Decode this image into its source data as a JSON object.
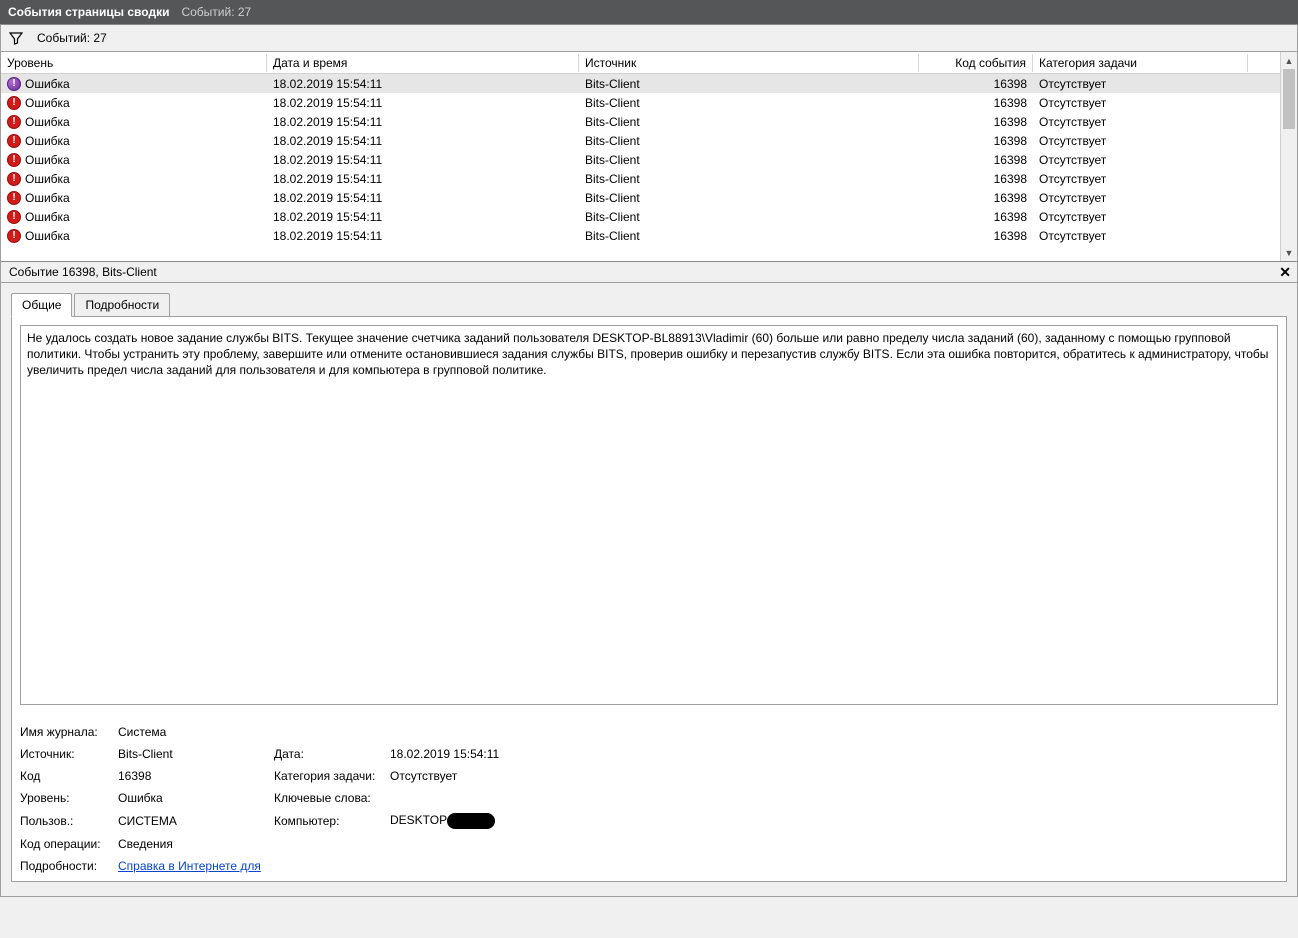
{
  "titlebar": {
    "title": "События страницы сводки",
    "subtitle": "Событий: 27"
  },
  "filterbar": {
    "count_label": "Событий: 27"
  },
  "columns": {
    "level": "Уровень",
    "date": "Дата и время",
    "source": "Источник",
    "code": "Код события",
    "category": "Категория задачи"
  },
  "events": [
    {
      "level": "Ошибка",
      "date": "18.02.2019 15:54:11",
      "source": "Bits-Client",
      "code": "16398",
      "category": "Отсутствует",
      "selected": true,
      "icon": "purple"
    },
    {
      "level": "Ошибка",
      "date": "18.02.2019 15:54:11",
      "source": "Bits-Client",
      "code": "16398",
      "category": "Отсутствует"
    },
    {
      "level": "Ошибка",
      "date": "18.02.2019 15:54:11",
      "source": "Bits-Client",
      "code": "16398",
      "category": "Отсутствует"
    },
    {
      "level": "Ошибка",
      "date": "18.02.2019 15:54:11",
      "source": "Bits-Client",
      "code": "16398",
      "category": "Отсутствует"
    },
    {
      "level": "Ошибка",
      "date": "18.02.2019 15:54:11",
      "source": "Bits-Client",
      "code": "16398",
      "category": "Отсутствует"
    },
    {
      "level": "Ошибка",
      "date": "18.02.2019 15:54:11",
      "source": "Bits-Client",
      "code": "16398",
      "category": "Отсутствует"
    },
    {
      "level": "Ошибка",
      "date": "18.02.2019 15:54:11",
      "source": "Bits-Client",
      "code": "16398",
      "category": "Отсутствует"
    },
    {
      "level": "Ошибка",
      "date": "18.02.2019 15:54:11",
      "source": "Bits-Client",
      "code": "16398",
      "category": "Отсутствует"
    },
    {
      "level": "Ошибка",
      "date": "18.02.2019 15:54:11",
      "source": "Bits-Client",
      "code": "16398",
      "category": "Отсутствует"
    }
  ],
  "detail": {
    "title": "Событие 16398, Bits-Client",
    "tabs": {
      "general": "Общие",
      "details": "Подробности"
    },
    "message": "Не удалось создать новое задание службы BITS. Текущее значение счетчика заданий пользователя DESKTOP-BL88913\\Vladimir (60) больше или равно пределу числа заданий (60), заданному с помощью групповой политики. Чтобы устранить эту проблему, завершите или отмените остановившиеся задания службы BITS, проверив ошибку и перезапустив службу BITS. Если эта ошибка повторится, обратитесь к администратору, чтобы увеличить предел числа заданий для пользователя и для компьютера в групповой политике.",
    "props": {
      "labels": {
        "log": "Имя журнала:",
        "source": "Источник:",
        "date": "Дата:",
        "code": "Код",
        "category": "Категория задачи:",
        "level": "Уровень:",
        "keywords": "Ключевые слова:",
        "user": "Пользов.:",
        "computer": "Компьютер:",
        "opcode": "Код операции:",
        "more": "Подробности:"
      },
      "values": {
        "log": "Система",
        "source": "Bits-Client",
        "date": "18.02.2019 15:54:11",
        "code": "16398",
        "category": "Отсутствует",
        "level": "Ошибка",
        "keywords": "",
        "user": "СИСТЕМА",
        "computer_prefix": "DESKTOP",
        "opcode": "Сведения",
        "more_link": "Справка в Интернете для"
      }
    }
  }
}
